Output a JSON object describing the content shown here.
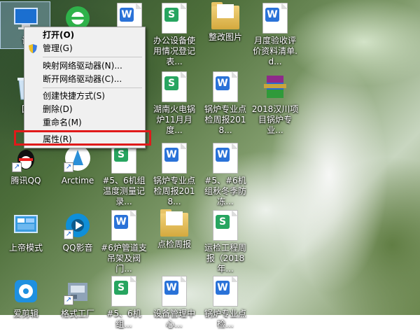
{
  "desktop": {
    "icons": [
      {
        "id": "computer",
        "label": "计"
      },
      {
        "id": "ie",
        "label": ""
      },
      {
        "id": "doc1",
        "label": ""
      },
      {
        "id": "sheet1",
        "label": "办公设备使用情况登记表..."
      },
      {
        "id": "folder1",
        "label": "整改图片"
      },
      {
        "id": "doc2",
        "label": "月度验收评价资料清单.d..."
      },
      {
        "id": "recycle",
        "label": "回"
      },
      {
        "id": "sheet2",
        "label": "湖南火电锅炉11月月度..."
      },
      {
        "id": "doc3",
        "label": "锅炉专业点检周报2018..."
      },
      {
        "id": "winrar",
        "label": "2018汉川项目锅炉专业..."
      },
      {
        "id": "qq",
        "label": "腾讯QQ"
      },
      {
        "id": "arctime",
        "label": "Arctime"
      },
      {
        "id": "sheet3",
        "label": "#5、6机组温度测量记录..."
      },
      {
        "id": "doc4",
        "label": "锅炉专业点检周报2018..."
      },
      {
        "id": "doc5",
        "label": "#5、#6机组秋冬季防冻..."
      },
      {
        "id": "emperor",
        "label": "上帝模式"
      },
      {
        "id": "qqplayer",
        "label": "QQ影音"
      },
      {
        "id": "doc6",
        "label": "#6炉管道支吊架及阀门..."
      },
      {
        "id": "folder2",
        "label": "点检周报"
      },
      {
        "id": "sheet4",
        "label": "运检工程周报（2018年..."
      },
      {
        "id": "aijianji",
        "label": "爱剪辑"
      },
      {
        "id": "geshi",
        "label": "格式工厂"
      },
      {
        "id": "sheet5",
        "label": "#5、6机组..."
      },
      {
        "id": "doc7",
        "label": "设备管理中心..."
      },
      {
        "id": "doc8",
        "label": "锅炉专业点检..."
      }
    ]
  },
  "context_menu": {
    "items": [
      {
        "label": "打开(O)"
      },
      {
        "label": "管理(G)"
      },
      {
        "label": "映射网络驱动器(N)..."
      },
      {
        "label": "断开网络驱动器(C)..."
      },
      {
        "label": "创建快捷方式(S)"
      },
      {
        "label": "删除(D)"
      },
      {
        "label": "重命名(M)"
      },
      {
        "label": "属性(R)"
      }
    ]
  },
  "colors": {
    "highlight_box": "#e01a1a",
    "word_badge": "#2a72d8",
    "sheet_badge": "#27a560"
  },
  "badges": {
    "word": "W",
    "sheet": "S",
    "shortcut": "↗"
  }
}
